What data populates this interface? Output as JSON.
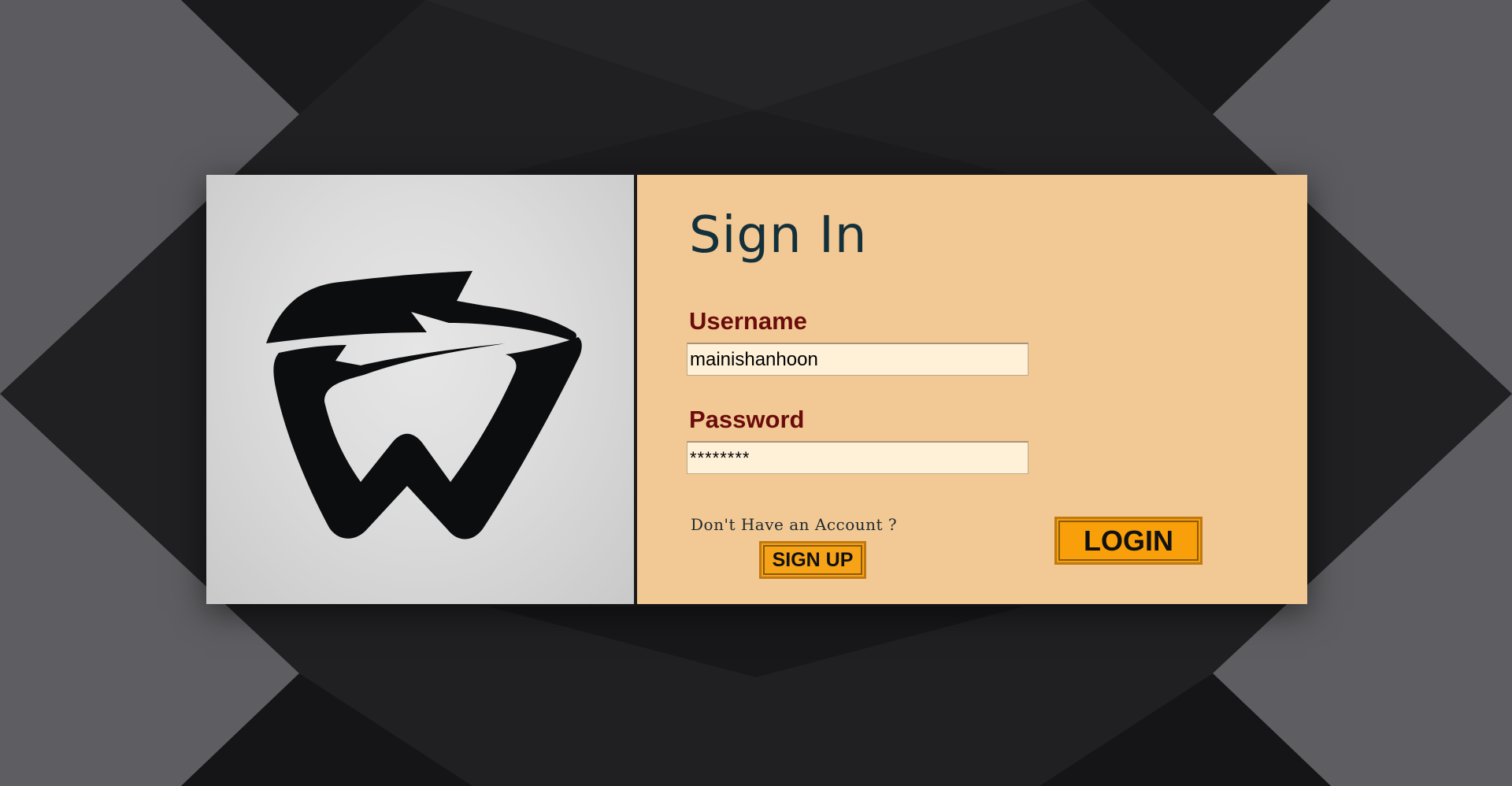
{
  "login_form": {
    "title": "Sign In",
    "username_label": "Username",
    "username_value": "mainishanhoon",
    "password_label": "Password",
    "password_value": "********",
    "no_account_text": "Don't Have an Account ?",
    "signup_button": "SIGN UP",
    "login_button": "LOGIN"
  },
  "logo": {
    "icon": "w-lightning-logo"
  },
  "colors": {
    "background": "#1f1f21",
    "logo_panel": "#dcdcdc",
    "form_panel": "#f2c894",
    "title": "#13303b",
    "label": "#6b0c0c",
    "input_bg": "#fff0d8",
    "button": "#f89f0a"
  }
}
